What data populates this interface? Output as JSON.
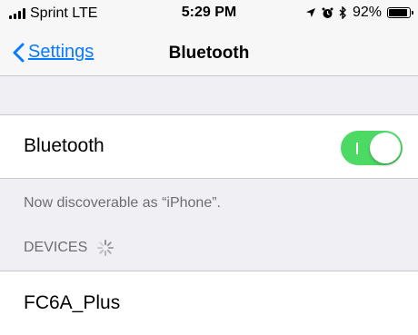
{
  "status_bar": {
    "carrier": "Sprint",
    "network": "LTE",
    "time": "5:29 PM",
    "battery_percent": "92%",
    "battery_level": 0.92,
    "icons": [
      "signal-icon",
      "location-icon",
      "alarm-icon",
      "bluetooth-icon",
      "battery-icon"
    ]
  },
  "nav": {
    "back_label": "Settings",
    "title": "Bluetooth"
  },
  "bluetooth": {
    "label": "Bluetooth",
    "enabled": true
  },
  "info": {
    "discoverable_text": "Now discoverable as “iPhone”.",
    "devices_header": "DEVICES"
  },
  "devices": [
    {
      "name": "FC6A_Plus"
    }
  ],
  "colors": {
    "accent": "#0a7aff",
    "toggle_on": "#4cd964",
    "group_background": "#efeff4",
    "secondary_text": "#6d6d72"
  }
}
